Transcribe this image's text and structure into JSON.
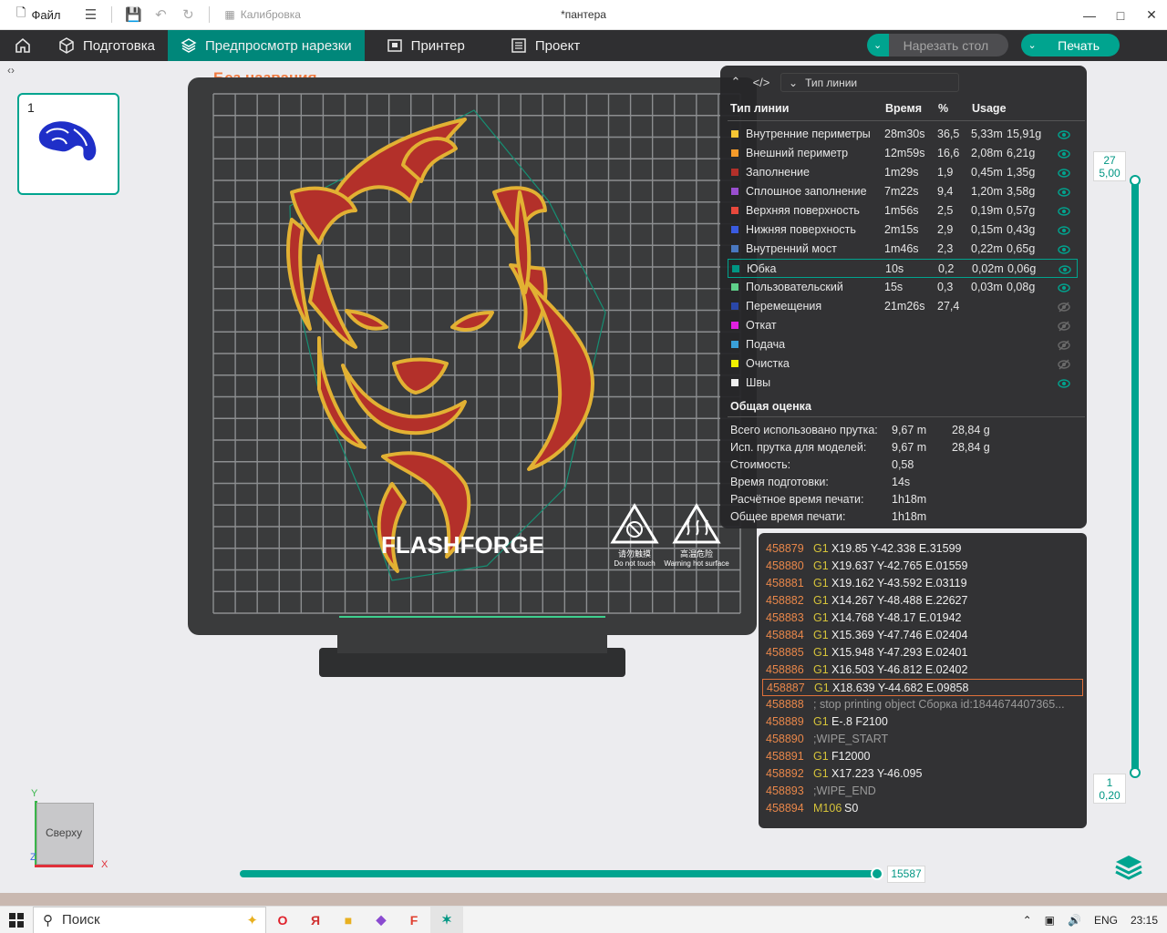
{
  "titlebar": {
    "file_label": "Файл",
    "calibration_label": "Калибровка",
    "window_title": "*пантера"
  },
  "nav": {
    "tabs": [
      {
        "label": "Подготовка"
      },
      {
        "label": "Предпросмотр нарезки"
      },
      {
        "label": "Принтер"
      },
      {
        "label": "Проект"
      }
    ],
    "slice_label": "Нарезать стол",
    "print_label": "Печать"
  },
  "plate": {
    "thumb_number": "1",
    "title": "Без названия",
    "brand": "FLASHFORGE",
    "warn1_cn": "请勿触摸",
    "warn1_en": "Do not touch",
    "warn2_cn": "高温危险",
    "warn2_en": "Warning hot surface"
  },
  "legend": {
    "select_label": "Тип линии",
    "col_type": "Тип линии",
    "col_time": "Время",
    "col_pct": "%",
    "col_usage": "Usage",
    "rows": [
      {
        "name": "Внутренние периметры",
        "time": "28m30s",
        "pct": "36,5",
        "len": "5,33m",
        "mass": "15,91g",
        "color": "#f7c634",
        "visible": true
      },
      {
        "name": "Внешний периметр",
        "time": "12m59s",
        "pct": "16,6",
        "len": "2,08m",
        "mass": "6,21g",
        "color": "#f59b2a",
        "visible": true
      },
      {
        "name": "Заполнение",
        "time": "1m29s",
        "pct": "1,9",
        "len": "0,45m",
        "mass": "1,35g",
        "color": "#b3302a",
        "visible": true
      },
      {
        "name": "Сплошное заполнение",
        "time": "7m22s",
        "pct": "9,4",
        "len": "1,20m",
        "mass": "3,58g",
        "color": "#9a4fd0",
        "visible": true
      },
      {
        "name": "Верхняя поверхность",
        "time": "1m56s",
        "pct": "2,5",
        "len": "0,19m",
        "mass": "0,57g",
        "color": "#e8483c",
        "visible": true
      },
      {
        "name": "Нижняя поверхность",
        "time": "2m15s",
        "pct": "2,9",
        "len": "0,15m",
        "mass": "0,43g",
        "color": "#3a5be0",
        "visible": true
      },
      {
        "name": "Внутренний мост",
        "time": "1m46s",
        "pct": "2,3",
        "len": "0,22m",
        "mass": "0,65g",
        "color": "#4a78c0",
        "visible": true
      },
      {
        "name": "Юбка",
        "time": "10s",
        "pct": "0,2",
        "len": "0,02m",
        "mass": "0,06g",
        "color": "#009683",
        "visible": true
      },
      {
        "name": "Пользовательский",
        "time": "15s",
        "pct": "0,3",
        "len": "0,03m",
        "mass": "0,08g",
        "color": "#5fd08a",
        "visible": true
      },
      {
        "name": "Перемещения",
        "time": "21m26s",
        "pct": "27,4",
        "len": "",
        "mass": "",
        "color": "#2a47a8",
        "visible": false
      },
      {
        "name": "Откат",
        "time": "",
        "pct": "",
        "len": "",
        "mass": "",
        "color": "#e020e0",
        "visible": false
      },
      {
        "name": "Подача",
        "time": "",
        "pct": "",
        "len": "",
        "mass": "",
        "color": "#3aa0d8",
        "visible": false
      },
      {
        "name": "Очистка",
        "time": "",
        "pct": "",
        "len": "",
        "mass": "",
        "color": "#f0f000",
        "visible": false
      },
      {
        "name": "Швы",
        "time": "",
        "pct": "",
        "len": "",
        "mass": "",
        "color": "#f0f0f0",
        "visible": true
      }
    ],
    "summary_title": "Общая оценка",
    "summary": [
      {
        "label": "Всего использовано прутка:",
        "v1": "9,67 m",
        "v2": "28,84 g"
      },
      {
        "label": "Исп. прутка для моделей:",
        "v1": "9,67 m",
        "v2": "28,84 g"
      },
      {
        "label": "Стоимость:",
        "v1": "0,58",
        "v2": ""
      },
      {
        "label": "Время подготовки:",
        "v1": "14s",
        "v2": ""
      },
      {
        "label": "Расчётное время печати:",
        "v1": "1h18m",
        "v2": ""
      },
      {
        "label": "Общее время печати:",
        "v1": "1h18m",
        "v2": ""
      }
    ]
  },
  "gcode": {
    "lines": [
      {
        "n": "458879",
        "cmd": "G1",
        "args": "X19.85 Y-42.338 E.31599",
        "comment": ""
      },
      {
        "n": "458880",
        "cmd": "G1",
        "args": "X19.637 Y-42.765 E.01559",
        "comment": ""
      },
      {
        "n": "458881",
        "cmd": "G1",
        "args": "X19.162 Y-43.592 E.03119",
        "comment": ""
      },
      {
        "n": "458882",
        "cmd": "G1",
        "args": "X14.267 Y-48.488 E.22627",
        "comment": ""
      },
      {
        "n": "458883",
        "cmd": "G1",
        "args": "X14.768 Y-48.17 E.01942",
        "comment": ""
      },
      {
        "n": "458884",
        "cmd": "G1",
        "args": "X15.369 Y-47.746 E.02404",
        "comment": ""
      },
      {
        "n": "458885",
        "cmd": "G1",
        "args": "X15.948 Y-47.293 E.02401",
        "comment": ""
      },
      {
        "n": "458886",
        "cmd": "G1",
        "args": "X16.503 Y-46.812 E.02402",
        "comment": ""
      },
      {
        "n": "458887",
        "cmd": "G1",
        "args": "X18.639 Y-44.682 E.09858",
        "comment": ""
      },
      {
        "n": "458888",
        "cmd": "",
        "args": "",
        "comment": "; stop printing object Сборка id:1844674407365..."
      },
      {
        "n": "458889",
        "cmd": "G1",
        "args": "E-.8 F2100",
        "comment": ""
      },
      {
        "n": "458890",
        "cmd": "",
        "args": "",
        "comment": ";WIPE_START"
      },
      {
        "n": "458891",
        "cmd": "G1",
        "args": "F12000",
        "comment": ""
      },
      {
        "n": "458892",
        "cmd": "G1",
        "args": "X17.223 Y-46.095",
        "comment": ""
      },
      {
        "n": "458893",
        "cmd": "",
        "args": "",
        "comment": ";WIPE_END"
      },
      {
        "n": "458894",
        "cmd": "M106",
        "args": "S0",
        "comment": ""
      }
    ],
    "current_index": 8
  },
  "layers": {
    "top_layer": "27",
    "top_height": "5,00",
    "bottom_layer": "1",
    "bottom_height": "0,20",
    "move_value": "15587"
  },
  "viewcube": {
    "label": "Сверху",
    "x": "X",
    "y": "Y",
    "z": "Z"
  },
  "taskbar": {
    "search": "Поиск",
    "lang": "ENG",
    "time": "23:15"
  },
  "colors": {
    "accent": "#00a48f",
    "title_orange": "#f07a40",
    "model_red": "#b3302a",
    "model_gold": "#e2b133"
  }
}
